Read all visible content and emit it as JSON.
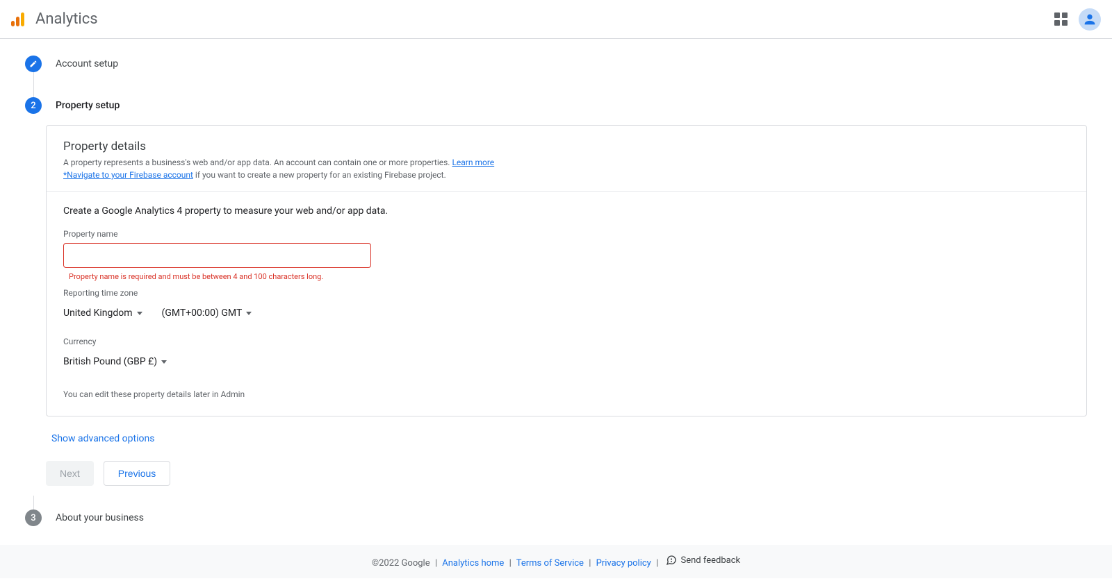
{
  "header": {
    "productName": "Analytics"
  },
  "stepper": {
    "step1": {
      "label": "Account setup"
    },
    "step2": {
      "number": "2",
      "label": "Property setup"
    },
    "step3": {
      "number": "3",
      "label": "About your business"
    }
  },
  "card": {
    "title": "Property details",
    "descPrefix": "A property represents a business's web and/or app data. An account can contain one or more properties. ",
    "learnMore": "Learn more",
    "firebaseLink": "*Navigate to your Firebase account",
    "descSuffix": " if you want to create a new property for an existing Firebase project."
  },
  "form": {
    "heading": "Create a Google Analytics 4 property to measure your web and/or app data.",
    "propertyName": {
      "label": "Property name",
      "value": "",
      "error": "Property name is required and must be between 4 and 100 characters long."
    },
    "timeZone": {
      "label": "Reporting time zone",
      "country": "United Kingdom",
      "zone": "(GMT+00:00) GMT"
    },
    "currency": {
      "label": "Currency",
      "value": "British Pound (GBP £)"
    },
    "hint": "You can edit these property details later in Admin"
  },
  "advancedLink": "Show advanced options",
  "buttons": {
    "next": "Next",
    "previous": "Previous"
  },
  "footer": {
    "copyright": "©2022 Google",
    "analyticsHome": "Analytics home",
    "tos": "Terms of Service",
    "privacy": "Privacy policy",
    "feedback": "Send feedback"
  }
}
